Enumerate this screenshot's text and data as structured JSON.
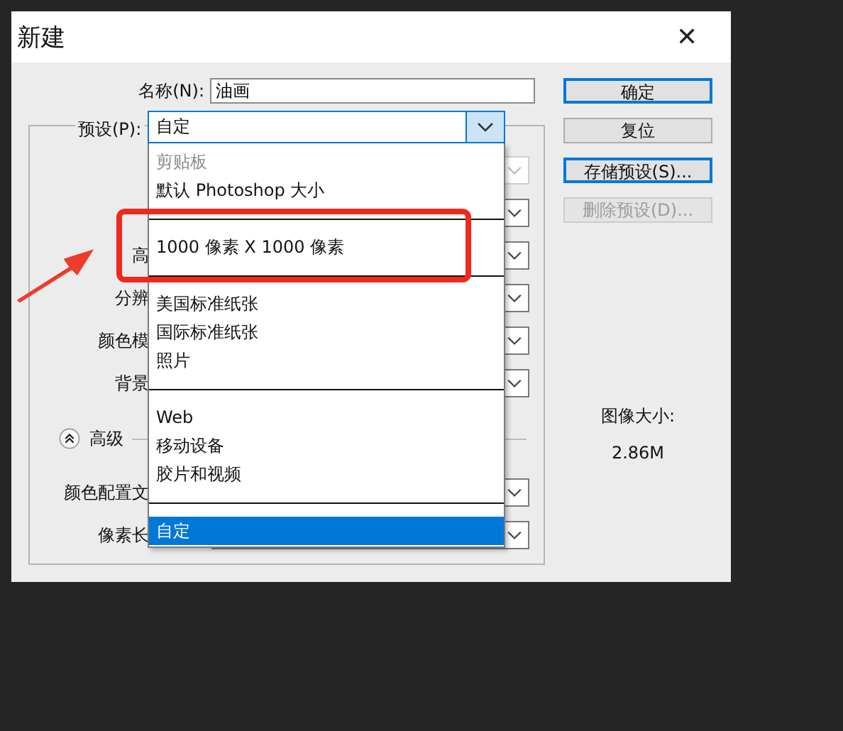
{
  "window": {
    "title": "新建",
    "close": "✕"
  },
  "name_field": {
    "label": "名称(N):",
    "value": "油画"
  },
  "preset": {
    "label": "预设(P):",
    "value": "自定",
    "expanded": true
  },
  "preset_menu": [
    {
      "kind": "item",
      "label": "剪贴板",
      "disabled": true,
      "selected": false
    },
    {
      "kind": "item",
      "label": "默认 Photoshop 大小",
      "disabled": false,
      "selected": false
    },
    {
      "kind": "separator"
    },
    {
      "kind": "item",
      "label": "1000 像素 X 1000 像素",
      "disabled": false,
      "selected": false
    },
    {
      "kind": "separator"
    },
    {
      "kind": "item",
      "label": "美国标准纸张",
      "disabled": false,
      "selected": false
    },
    {
      "kind": "item",
      "label": "国际标准纸张",
      "disabled": false,
      "selected": false
    },
    {
      "kind": "item",
      "label": "照片",
      "disabled": false,
      "selected": false
    },
    {
      "kind": "separator"
    },
    {
      "kind": "item",
      "label": "Web",
      "disabled": false,
      "selected": false
    },
    {
      "kind": "item",
      "label": "移动设备",
      "disabled": false,
      "selected": false
    },
    {
      "kind": "item",
      "label": "胶片和视频",
      "disabled": false,
      "selected": false
    },
    {
      "kind": "separator"
    },
    {
      "kind": "item",
      "label": "自定",
      "disabled": false,
      "selected": true
    }
  ],
  "fields": [
    {
      "disabled": true
    },
    {
      "disabled": false
    },
    {
      "label_partial": "高",
      "disabled": false
    },
    {
      "label_partial": "分辨",
      "disabled": false
    },
    {
      "label_partial": "颜色模",
      "disabled": false
    },
    {
      "label_partial": "背景",
      "disabled": false
    }
  ],
  "advanced": {
    "label": "高级",
    "expanded": true,
    "fields": [
      {
        "label_partial": "颜色配置文",
        "disabled": false
      },
      {
        "label_partial": "像素长",
        "disabled": false
      }
    ]
  },
  "buttons": [
    {
      "label": "确定",
      "disabled": false,
      "default": true
    },
    {
      "label": "复位",
      "disabled": false,
      "default": false
    },
    {
      "label": "存储预设(S)...",
      "disabled": false,
      "default": true
    },
    {
      "label": "删除预设(D)...",
      "disabled": true,
      "default": false
    }
  ],
  "image_size": {
    "label": "图像大小:",
    "value": "2.86M"
  }
}
